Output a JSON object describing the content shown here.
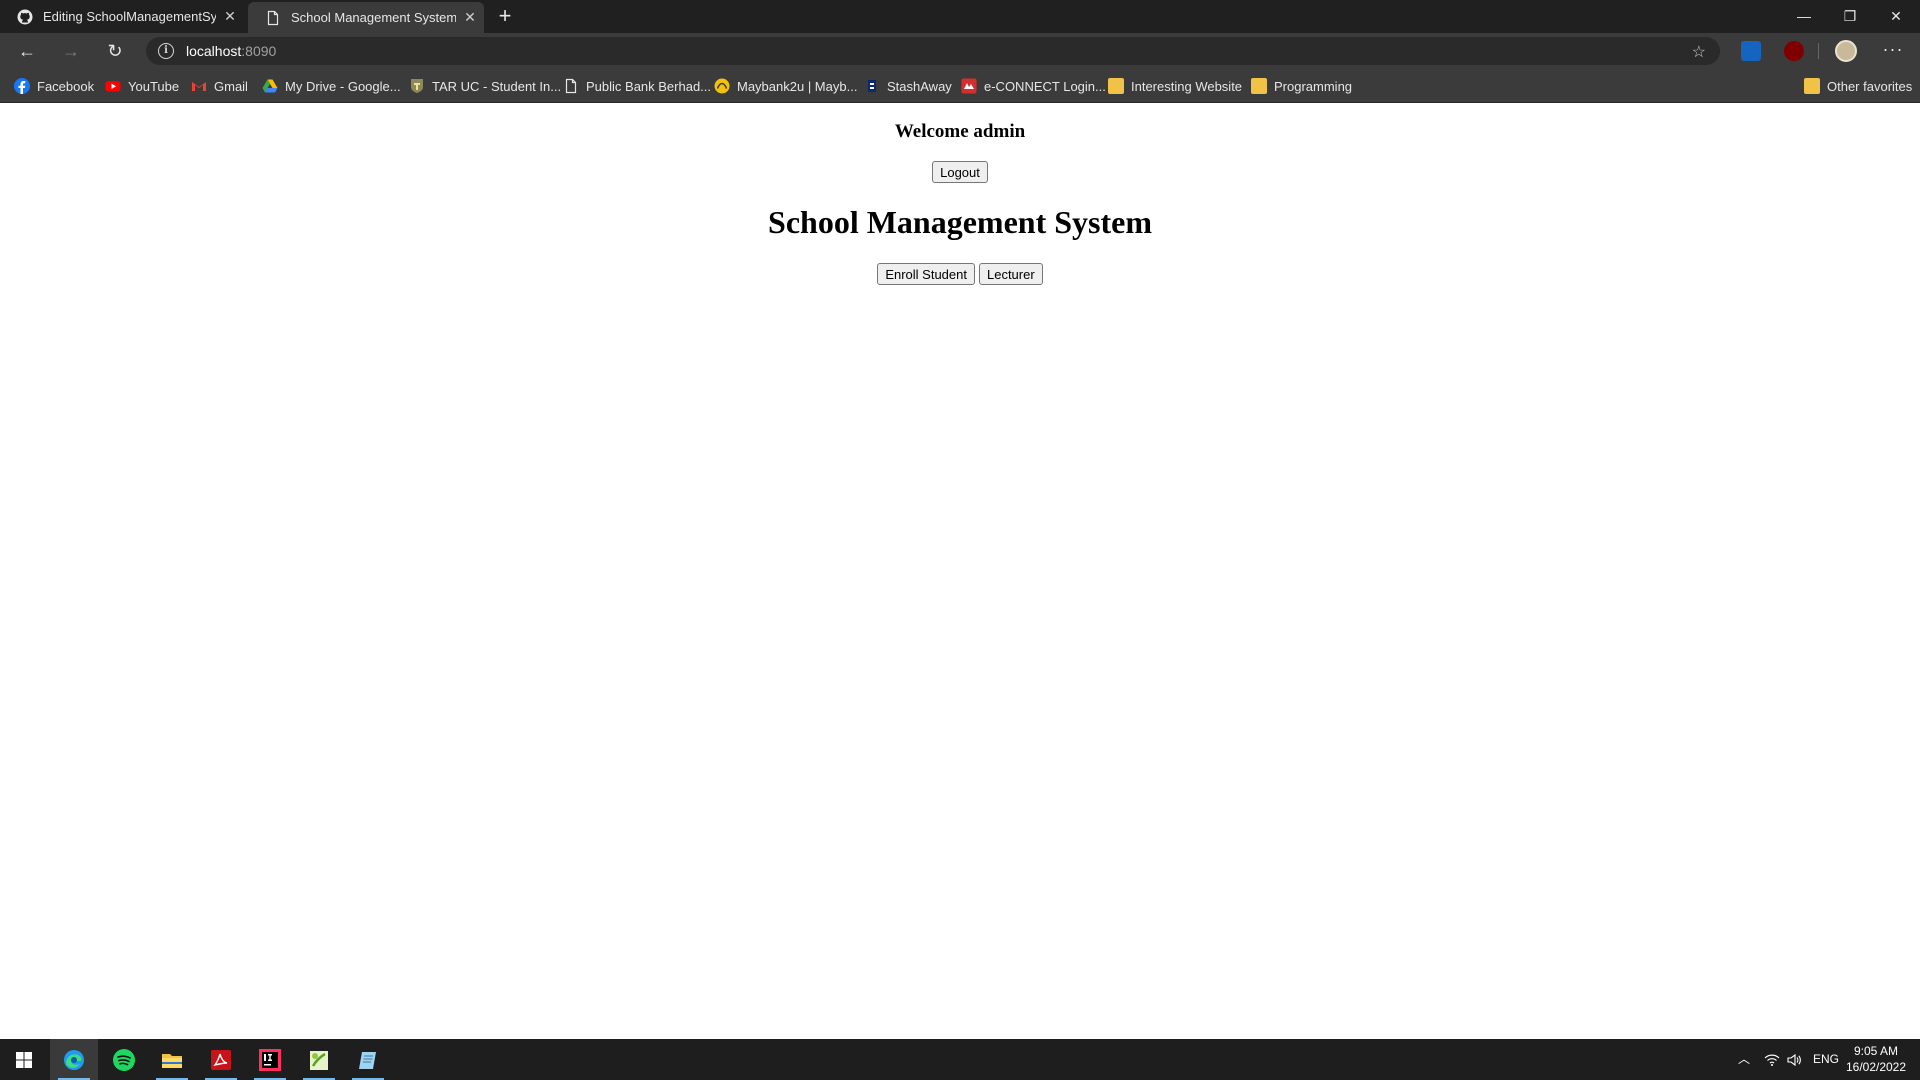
{
  "browser": {
    "tabs": [
      {
        "title": "Editing SchoolManagementSyste",
        "icon": "github-icon",
        "active": false
      },
      {
        "title": "School Management System",
        "icon": "page-icon",
        "active": true
      }
    ],
    "new_tab_icon": "plus-icon",
    "window_controls": [
      "minimize-icon",
      "restore-icon",
      "close-icon"
    ],
    "address": {
      "host": "localhost",
      "port": ":8090"
    },
    "bookmarks": [
      {
        "label": "Facebook",
        "icon": "facebook-icon"
      },
      {
        "label": "YouTube",
        "icon": "youtube-icon"
      },
      {
        "label": "Gmail",
        "icon": "gmail-icon"
      },
      {
        "label": "My Drive - Google...",
        "icon": "google-drive-icon"
      },
      {
        "label": "TAR UC - Student In...",
        "icon": "tarc-icon"
      },
      {
        "label": "Public Bank Berhad...",
        "icon": "page-icon"
      },
      {
        "label": "Maybank2u | Mayb...",
        "icon": "maybank-icon"
      },
      {
        "label": "StashAway",
        "icon": "stashaway-icon"
      },
      {
        "label": "e-CONNECT Login...",
        "icon": "econnect-icon"
      },
      {
        "label": "Interesting Website",
        "icon": "folder-icon"
      },
      {
        "label": "Programming",
        "icon": "folder-icon"
      }
    ],
    "other_favorites": "Other favorites"
  },
  "page": {
    "welcome": "Welcome admin",
    "logout_label": "Logout",
    "title": "School Management System",
    "actions": {
      "enroll_label": "Enroll Student",
      "lecturer_label": "Lecturer"
    }
  },
  "taskbar": {
    "apps": [
      "windows-start-icon",
      "edge-icon",
      "spotify-icon",
      "file-explorer-icon",
      "acrobat-icon",
      "intellij-icon",
      "notepad-plus-icon",
      "notepad-icon"
    ],
    "tray": {
      "language": "ENG",
      "time": "9:05 AM",
      "date": "16/02/2022"
    }
  },
  "colors": {
    "titlebar": "#202020",
    "toolbar": "#3b3b3b",
    "taskbar": "#1e1e1e",
    "accent": "#76b9ed"
  }
}
